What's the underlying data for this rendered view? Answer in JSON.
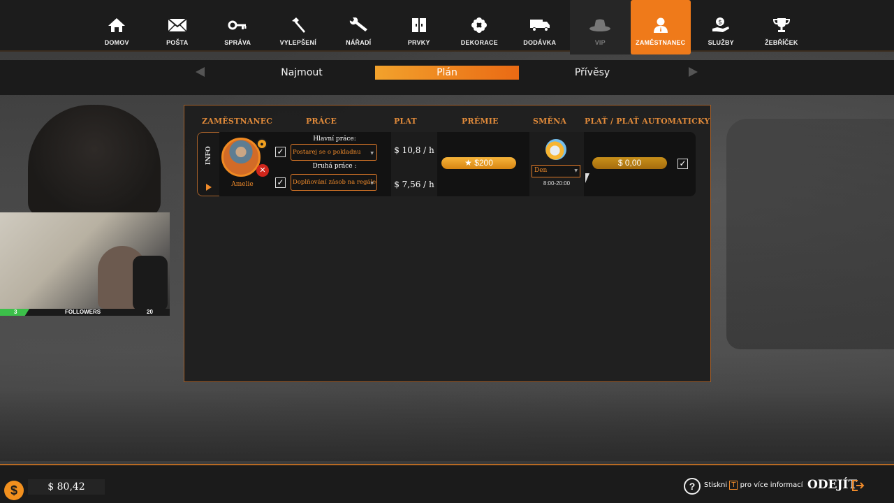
{
  "nav": {
    "items": [
      {
        "label": "DOMOV",
        "icon": "home-icon"
      },
      {
        "label": "POŠTA",
        "icon": "mail-icon"
      },
      {
        "label": "SPRÁVA",
        "icon": "key-icon"
      },
      {
        "label": "VYLEPŠENÍ",
        "icon": "hammer-icon"
      },
      {
        "label": "NÁŘADÍ",
        "icon": "wrench-icon"
      },
      {
        "label": "PRVKY",
        "icon": "cabinet-icon"
      },
      {
        "label": "DEKORACE",
        "icon": "flower-icon"
      },
      {
        "label": "DODÁVKA",
        "icon": "truck-icon"
      },
      {
        "label": "VIP",
        "icon": "hat-icon"
      },
      {
        "label": "ZAMĚSTNANEC",
        "icon": "employee-icon"
      },
      {
        "label": "SLUŽBY",
        "icon": "money-hand-icon"
      },
      {
        "label": "ŽEBŘÍČEK",
        "icon": "trophy-icon"
      }
    ],
    "active": "ZAMĚSTNANEC"
  },
  "subtabs": {
    "items": [
      "Najmout",
      "Plán",
      "Přívěsy"
    ],
    "active": "Plán"
  },
  "webcam": {
    "followers_current": "3",
    "followers_label": "FOLLOWERS",
    "followers_goal": "20"
  },
  "table": {
    "headers": {
      "employee": "ZAMĚSTNANEC",
      "job": "PRÁCE",
      "pay": "PLAT",
      "bonus": "PRÉMIE",
      "shift": "SMĚNA",
      "auto_pay": "PLAŤ / PLAŤ AUTOMATICKY"
    },
    "rows": [
      {
        "info_label": "INFO",
        "name": "Amelie",
        "main_job_label": "Hlavní práce:",
        "main_job": "Postarej se o pokladnu",
        "main_job_checked": true,
        "second_job_label": "Druhá práce :",
        "second_job": "Doplňování zásob na regálech",
        "second_job_checked": true,
        "main_pay": "$ 10,8 / h",
        "second_pay": "$ 7,56 / h",
        "bonus": "$200",
        "shift": "Den",
        "shift_time": "8:00-20:00",
        "auto_pay": "$ 0,00",
        "auto_pay_checked": true
      }
    ]
  },
  "bottom": {
    "money": "$ 80,42",
    "help_prefix": "Stiskni",
    "help_key": "T",
    "help_suffix": "pro více informací",
    "exit_label": "ODEJÍT"
  },
  "colors": {
    "accent": "#ef7a1a",
    "panel_border": "#a4602a",
    "bonus_gold": "#f2a22c",
    "danger": "#d0251b"
  }
}
